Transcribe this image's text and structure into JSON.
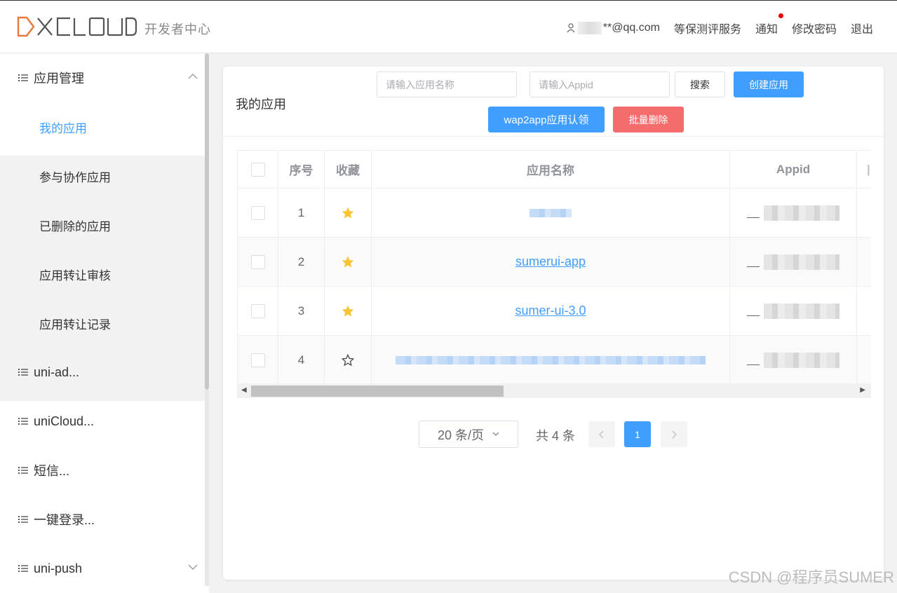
{
  "header": {
    "logo_text": "DCLOUD",
    "subtitle": "开发者中心",
    "user_email_suffix": "**@qq.com",
    "nav": [
      "等保测评服务",
      "通知",
      "修改密码",
      "退出"
    ],
    "user_icon": "user-icon",
    "accent_color": "#e8793a"
  },
  "sidebar": {
    "groups": [
      {
        "label": "应用管理",
        "expanded": true
      },
      {
        "label": "uni-ad..."
      },
      {
        "label": "uniCloud..."
      },
      {
        "label": "短信..."
      },
      {
        "label": "一键登录..."
      },
      {
        "label": "uni-push"
      }
    ],
    "subitems": [
      "我的应用",
      "参与协作应用",
      "已删除的应用",
      "应用转让审核",
      "应用转让记录"
    ],
    "active_subitem": "我的应用"
  },
  "main": {
    "title": "我的应用",
    "search_name_placeholder": "请输入应用名称",
    "search_appid_placeholder": "请输入Appid",
    "search_button": "搜索",
    "create_button": "创建应用",
    "wap2app_button": "wap2app应用认领",
    "batch_delete_button": "批量删除"
  },
  "table": {
    "headers": [
      "序号",
      "收藏",
      "应用名称",
      "Appid"
    ],
    "rows": [
      {
        "index": "1",
        "favorited": true,
        "name": "",
        "appid_prefix": "__"
      },
      {
        "index": "2",
        "favorited": true,
        "name": "sumerui-app",
        "appid_prefix": "__"
      },
      {
        "index": "3",
        "favorited": true,
        "name": "sumer-ui-3.0",
        "appid_prefix": "__"
      },
      {
        "index": "4",
        "favorited": false,
        "name": "",
        "appid_prefix": "__"
      }
    ]
  },
  "pagination": {
    "page_size": "20 条/页",
    "total": "共 4 条",
    "current_page": "1"
  },
  "watermark": "CSDN @程序员SUMER",
  "colors": {
    "primary": "#409eff",
    "danger": "#f56c6c",
    "star": "#f7c531"
  }
}
